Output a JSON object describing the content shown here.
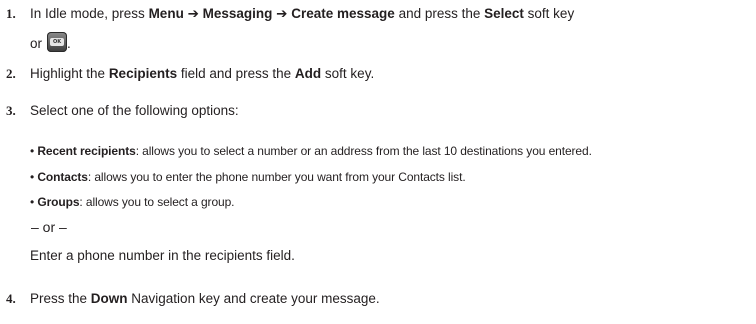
{
  "steps": [
    {
      "number": "1.",
      "text": {
        "a": "In Idle mode, press ",
        "menu": "Menu",
        "arrow1": " ➔ ",
        "messaging": "Messaging",
        "arrow2": "  ➔ ",
        "create": "Create message",
        "b": " and press the ",
        "select": "Select",
        "c": " soft key",
        "or": "or",
        "end": "."
      },
      "icon": "ok-key-icon",
      "icon_label": "OK"
    },
    {
      "number": "2.",
      "text": {
        "a": "Highlight the ",
        "recipients": "Recipients",
        "b": " field and press the ",
        "add": "Add",
        "c": " soft key."
      }
    },
    {
      "number": "3.",
      "text": "Select one of the following options:",
      "options": [
        {
          "bullet": "•",
          "label": "Recent recipients",
          "desc": ": allows you to select a number or an address from the last 10 destinations you entered."
        },
        {
          "bullet": "•",
          "label": "Contacts",
          "desc": ": allows you to enter the phone number you want from your Contacts list."
        },
        {
          "bullet": "•",
          "label": "Groups",
          "desc": ": allows you to select a group."
        }
      ],
      "separator": "– or –",
      "alternative": "Enter a phone number in the recipients field."
    },
    {
      "number": "4.",
      "text": {
        "a": "Press the ",
        "down": "Down",
        "b": " Navigation key and create your message."
      }
    }
  ]
}
